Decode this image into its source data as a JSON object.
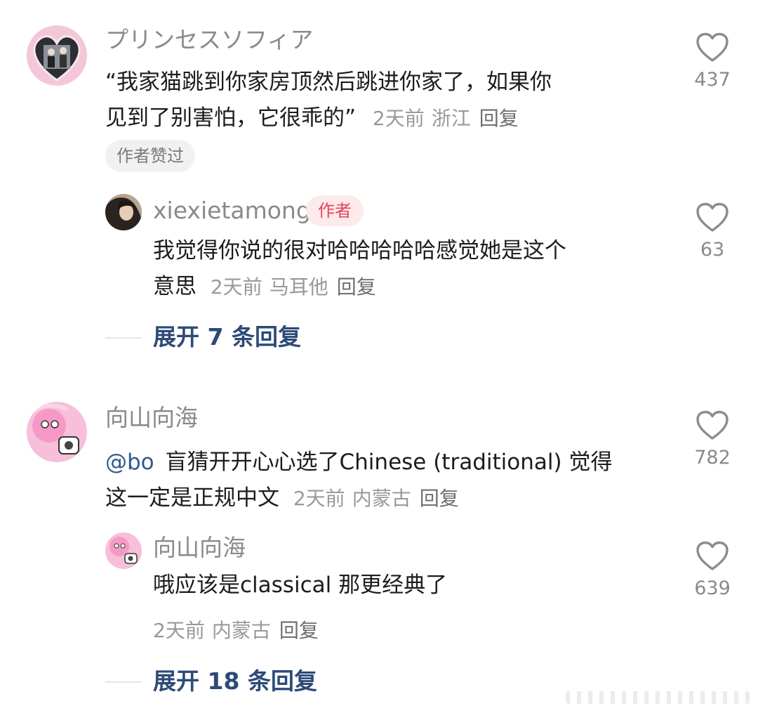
{
  "comments": [
    {
      "user": "プリンセスソフィア",
      "text_line1": "“我家猫跳到你家房顶然后跳进你家了，如果你",
      "text_line2": "见到了别害怕，它很乖的”",
      "time": "2天前",
      "location": "浙江",
      "reply_label": "回复",
      "liked_badge": "作者赞过",
      "likes": "437",
      "reply": {
        "user": "xiexietamong",
        "author_tag": "作者",
        "text_line1": "我觉得你说的很对哈哈哈哈哈感觉她是这个",
        "text_line2": "意思",
        "time": "2天前",
        "location": "马耳他",
        "reply_label": "回复",
        "likes": "63"
      },
      "expand": "展开 7 条回复"
    },
    {
      "user": "向山向海",
      "mention": "@bo",
      "text_line1": "盲猜开开心心选了Chinese (traditional) 觉得",
      "text_line2": "这一定是正规中文",
      "time": "2天前",
      "location": "内蒙古",
      "reply_label": "回复",
      "likes": "782",
      "reply": {
        "user": "向山向海",
        "text_line1": "哦应该是classical 那更经典了",
        "time": "2天前",
        "location": "内蒙古",
        "reply_label": "回复",
        "likes": "639"
      },
      "expand": "展开 18 条回复"
    }
  ],
  "colors": {
    "username": "#8a8a8a",
    "mention": "#2f5a8c",
    "expand": "#2d4a78",
    "author_tag_bg": "#fdeaea",
    "author_tag_fg": "#e0475c"
  },
  "icons": {
    "like": "heart-outline-icon"
  }
}
